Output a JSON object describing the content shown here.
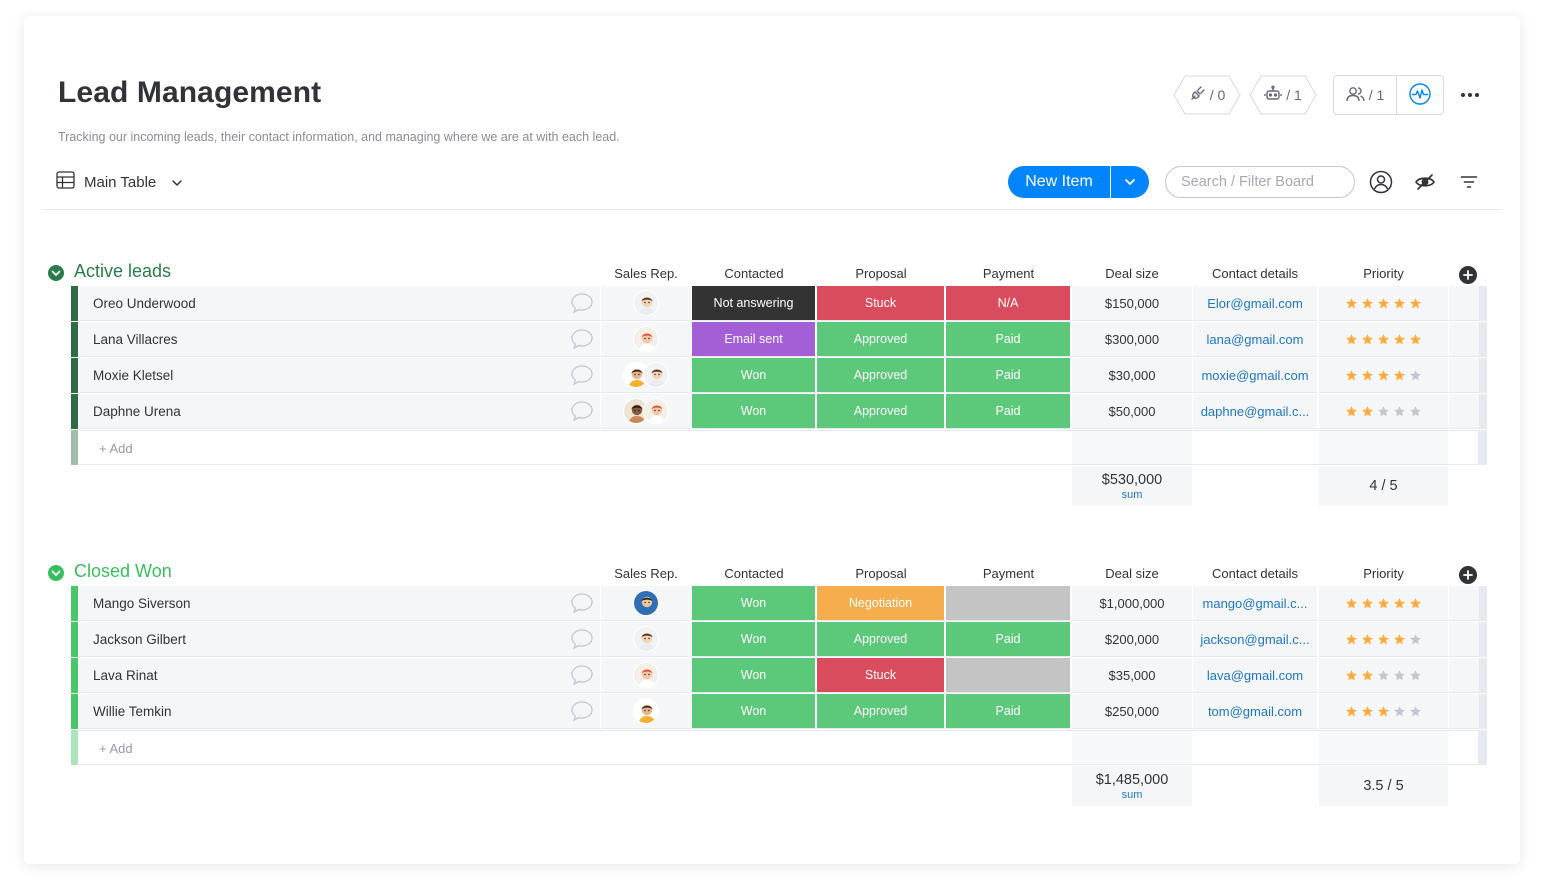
{
  "board": {
    "title": "Lead Management",
    "description": "Tracking our incoming leads, their contact information, and managing where we are at with each lead."
  },
  "header": {
    "integrations_count": "/ 0",
    "automations_count": "/ 1",
    "members_count": "/ 1",
    "integrations_icon": "plug-icon",
    "automations_icon": "robot-icon",
    "members_icon": "people-icon",
    "activity_icon": "activity-icon"
  },
  "view": {
    "label": "Main Table",
    "icon": "table-icon"
  },
  "toolbar": {
    "new_item_label": "New Item",
    "search_placeholder": "Search / Filter Board"
  },
  "colors": {
    "primary": "#0085ff",
    "done": "#5cc87a",
    "stuck": "#d84c5e",
    "working": "#f5ad4d",
    "dark": "#333333",
    "purple": "#a45fd6",
    "empty": "#c4c4c4",
    "group_active": "#2b7c4a",
    "group_won": "#38bf5d",
    "link": "#1f76c2",
    "star": "#fdab3d"
  },
  "columns": {
    "sales_rep": "Sales Rep.",
    "contacted": "Contacted",
    "proposal": "Proposal",
    "payment": "Payment",
    "deal_size": "Deal size",
    "contact_details": "Contact details",
    "priority": "Priority"
  },
  "groups": [
    {
      "title": "Active leads",
      "color": "#2b7c4a",
      "edge_color": "#2f6c44",
      "add_label": "+ Add",
      "sum_value": "$530,000",
      "sum_label": "sum",
      "priority_summary": "4 / 5",
      "rows": [
        {
          "name": "Oreo Underwood",
          "reps": 1,
          "contacted": "Not answering",
          "contacted_color": "#333333",
          "proposal": "Stuck",
          "proposal_color": "#d84c5e",
          "payment": "N/A",
          "payment_color": "#d84c5e",
          "deal": "$150,000",
          "email": "Elor@gmail.com",
          "stars": 5
        },
        {
          "name": "Lana Villacres",
          "reps": 1,
          "contacted": "Email sent",
          "contacted_color": "#a45fd6",
          "proposal": "Approved",
          "proposal_color": "#5cc87a",
          "payment": "Paid",
          "payment_color": "#5cc87a",
          "deal": "$300,000",
          "email": "lana@gmail.com",
          "stars": 5
        },
        {
          "name": "Moxie Kletsel",
          "reps": 2,
          "contacted": "Won",
          "contacted_color": "#5cc87a",
          "proposal": "Approved",
          "proposal_color": "#5cc87a",
          "payment": "Paid",
          "payment_color": "#5cc87a",
          "deal": "$30,000",
          "email": "moxie@gmail.com",
          "stars": 4
        },
        {
          "name": "Daphne Urena",
          "reps": 2,
          "contacted": "Won",
          "contacted_color": "#5cc87a",
          "proposal": "Approved",
          "proposal_color": "#5cc87a",
          "payment": "Paid",
          "payment_color": "#5cc87a",
          "deal": "$50,000",
          "email": "daphne@gmail.c...",
          "stars": 2
        }
      ]
    },
    {
      "title": "Closed Won",
      "color": "#38bf5d",
      "edge_color": "#4cc46a",
      "add_label": "+ Add",
      "sum_value": "$1,485,000",
      "sum_label": "sum",
      "priority_summary": "3.5 / 5",
      "rows": [
        {
          "name": "Mango Siverson",
          "reps": 1,
          "contacted": "Won",
          "contacted_color": "#5cc87a",
          "proposal": "Negotiation",
          "proposal_color": "#f5ad4d",
          "payment": "",
          "payment_color": "#c4c4c4",
          "deal": "$1,000,000",
          "email": "mango@gmail.c...",
          "stars": 5
        },
        {
          "name": "Jackson Gilbert",
          "reps": 1,
          "contacted": "Won",
          "contacted_color": "#5cc87a",
          "proposal": "Approved",
          "proposal_color": "#5cc87a",
          "payment": "Paid",
          "payment_color": "#5cc87a",
          "deal": "$200,000",
          "email": "jackson@gmail.c...",
          "stars": 4
        },
        {
          "name": "Lava Rinat",
          "reps": 1,
          "contacted": "Won",
          "contacted_color": "#5cc87a",
          "proposal": "Stuck",
          "proposal_color": "#d84c5e",
          "payment": "",
          "payment_color": "#c4c4c4",
          "deal": "$35,000",
          "email": "lava@gmail.com",
          "stars": 2
        },
        {
          "name": "Willie Temkin",
          "reps": 1,
          "contacted": "Won",
          "contacted_color": "#5cc87a",
          "proposal": "Approved",
          "proposal_color": "#5cc87a",
          "payment": "Paid",
          "payment_color": "#5cc87a",
          "deal": "$250,000",
          "email": "tom@gmail.com",
          "stars": 3
        }
      ]
    }
  ]
}
